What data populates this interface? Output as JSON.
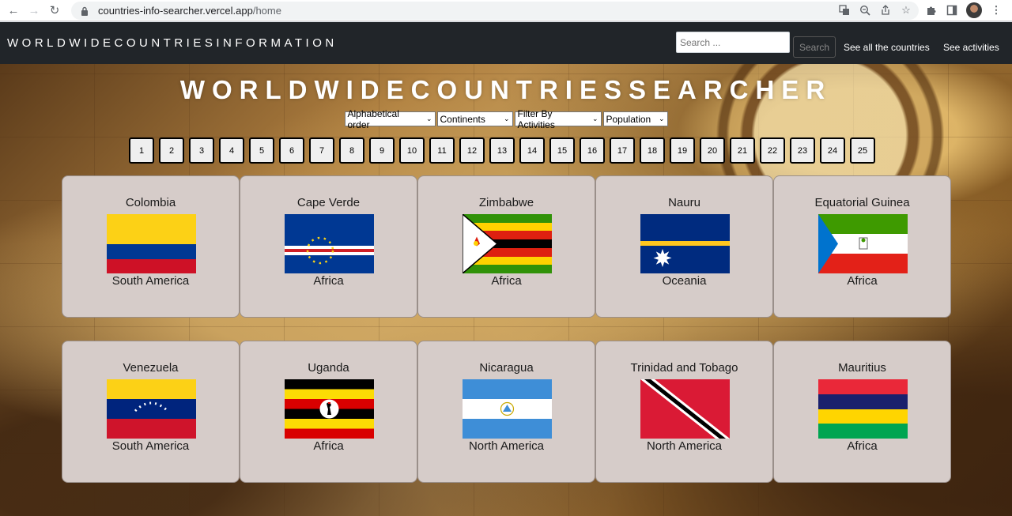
{
  "browser": {
    "url_host": "countries-info-searcher.vercel.app",
    "url_path": "/home"
  },
  "navbar": {
    "brand": "WORLDWIDECOUNTRIESINFORMATION",
    "search_placeholder": "Search ...",
    "search_button": "Search",
    "link_all": "See all the countries",
    "link_activities": "See activities"
  },
  "main": {
    "title": "WORLDWIDECOUNTRIESSEARCHER",
    "filters": {
      "order": "Alphabetical order",
      "continents": "Continents",
      "activities": "Filter By Activities",
      "population": "Population"
    },
    "pages": [
      "1",
      "2",
      "3",
      "4",
      "5",
      "6",
      "7",
      "8",
      "9",
      "10",
      "11",
      "12",
      "13",
      "14",
      "15",
      "16",
      "17",
      "18",
      "19",
      "20",
      "21",
      "22",
      "23",
      "24",
      "25"
    ],
    "countries": [
      {
        "name": "Colombia",
        "continent": "South America",
        "flag": "colombia"
      },
      {
        "name": "Cape Verde",
        "continent": "Africa",
        "flag": "cape-verde"
      },
      {
        "name": "Zimbabwe",
        "continent": "Africa",
        "flag": "zimbabwe"
      },
      {
        "name": "Nauru",
        "continent": "Oceania",
        "flag": "nauru"
      },
      {
        "name": "Equatorial Guinea",
        "continent": "Africa",
        "flag": "equatorial-guinea"
      },
      {
        "name": "Venezuela",
        "continent": "South America",
        "flag": "venezuela"
      },
      {
        "name": "Uganda",
        "continent": "Africa",
        "flag": "uganda"
      },
      {
        "name": "Nicaragua",
        "continent": "North America",
        "flag": "nicaragua"
      },
      {
        "name": "Trinidad and Tobago",
        "continent": "North America",
        "flag": "trinidad-and-tobago"
      },
      {
        "name": "Mauritius",
        "continent": "Africa",
        "flag": "mauritius"
      }
    ]
  }
}
